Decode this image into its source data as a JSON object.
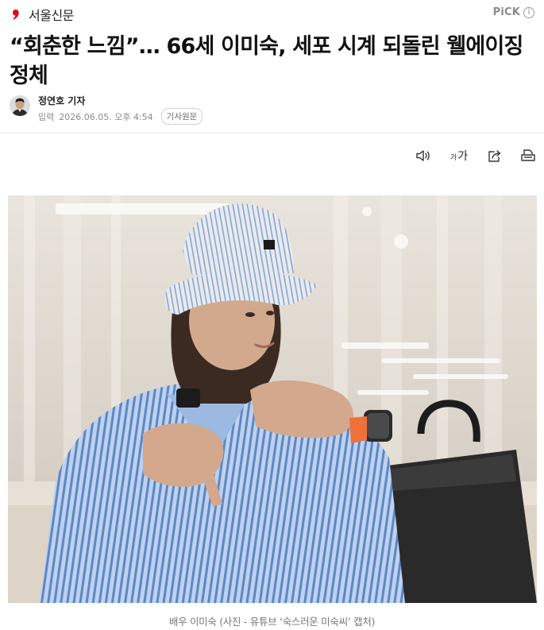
{
  "header": {
    "press_name": "서울신문",
    "pick_label": "PiCK",
    "info_symbol": "i",
    "icons": {
      "press_logo": "seoul-shinmun-logo",
      "info": "info-circle-icon"
    }
  },
  "article": {
    "headline": "“회춘한 느낌”… 66세 이미숙, 세포 시계 되돌린 웰에이징 정체",
    "reporter": "정연호 기자",
    "date_prefix": "입력",
    "date": "2026.06.05. 오후 4:54",
    "origin_button": "기사원문",
    "photo_caption": "배우 이미숙 (사진 - 유튜브 ‘숙스러운 미숙씨’ 캡처)"
  },
  "toolbar": {
    "font_small": "가",
    "font_large": "가",
    "icons": [
      "speaker-icon",
      "font-size-icon",
      "share-icon",
      "print-icon"
    ]
  },
  "colors": {
    "press_logo_red": "#e60012",
    "text_primary": "#111111",
    "text_muted": "#8a8a8a"
  }
}
